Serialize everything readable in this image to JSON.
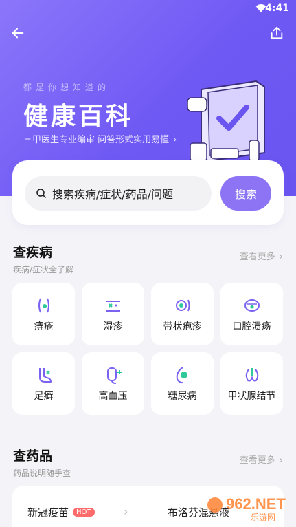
{
  "status": {
    "time": "4:41"
  },
  "hero": {
    "slogan": "都是你想知道的",
    "title": "健康百科",
    "subtitle": "三甲医生专业编审 问答形式实用易懂"
  },
  "search": {
    "placeholder": "搜索疾病/症状/药品/问题",
    "button": "搜索"
  },
  "disease_section": {
    "title": "查疾病",
    "subtitle": "疾病/症状全了解",
    "more": "查看更多",
    "items": [
      {
        "label": "痔疮",
        "icon": "hemorrhoid-icon"
      },
      {
        "label": "湿疹",
        "icon": "eczema-icon"
      },
      {
        "label": "带状疱疹",
        "icon": "herpes-icon"
      },
      {
        "label": "口腔溃疡",
        "icon": "mouth-ulcer-icon"
      },
      {
        "label": "足癣",
        "icon": "foot-icon"
      },
      {
        "label": "高血压",
        "icon": "blood-pressure-icon"
      },
      {
        "label": "糖尿病",
        "icon": "diabetes-icon"
      },
      {
        "label": "甲状腺结节",
        "icon": "thyroid-icon"
      }
    ]
  },
  "drug_section": {
    "title": "查药品",
    "subtitle": "药品说明随手查",
    "more": "查看更多",
    "items": [
      {
        "label": "新冠疫苗",
        "badge": "HOT"
      },
      {
        "label": "布洛芬混悬液"
      }
    ]
  },
  "watermark": {
    "text": "962.NET",
    "subtext": "乐游网"
  },
  "colors": {
    "accent": "#8c74f5",
    "hero": "#6f59f4",
    "icon_purple": "#7b62f0",
    "icon_green": "#2fc89a"
  }
}
